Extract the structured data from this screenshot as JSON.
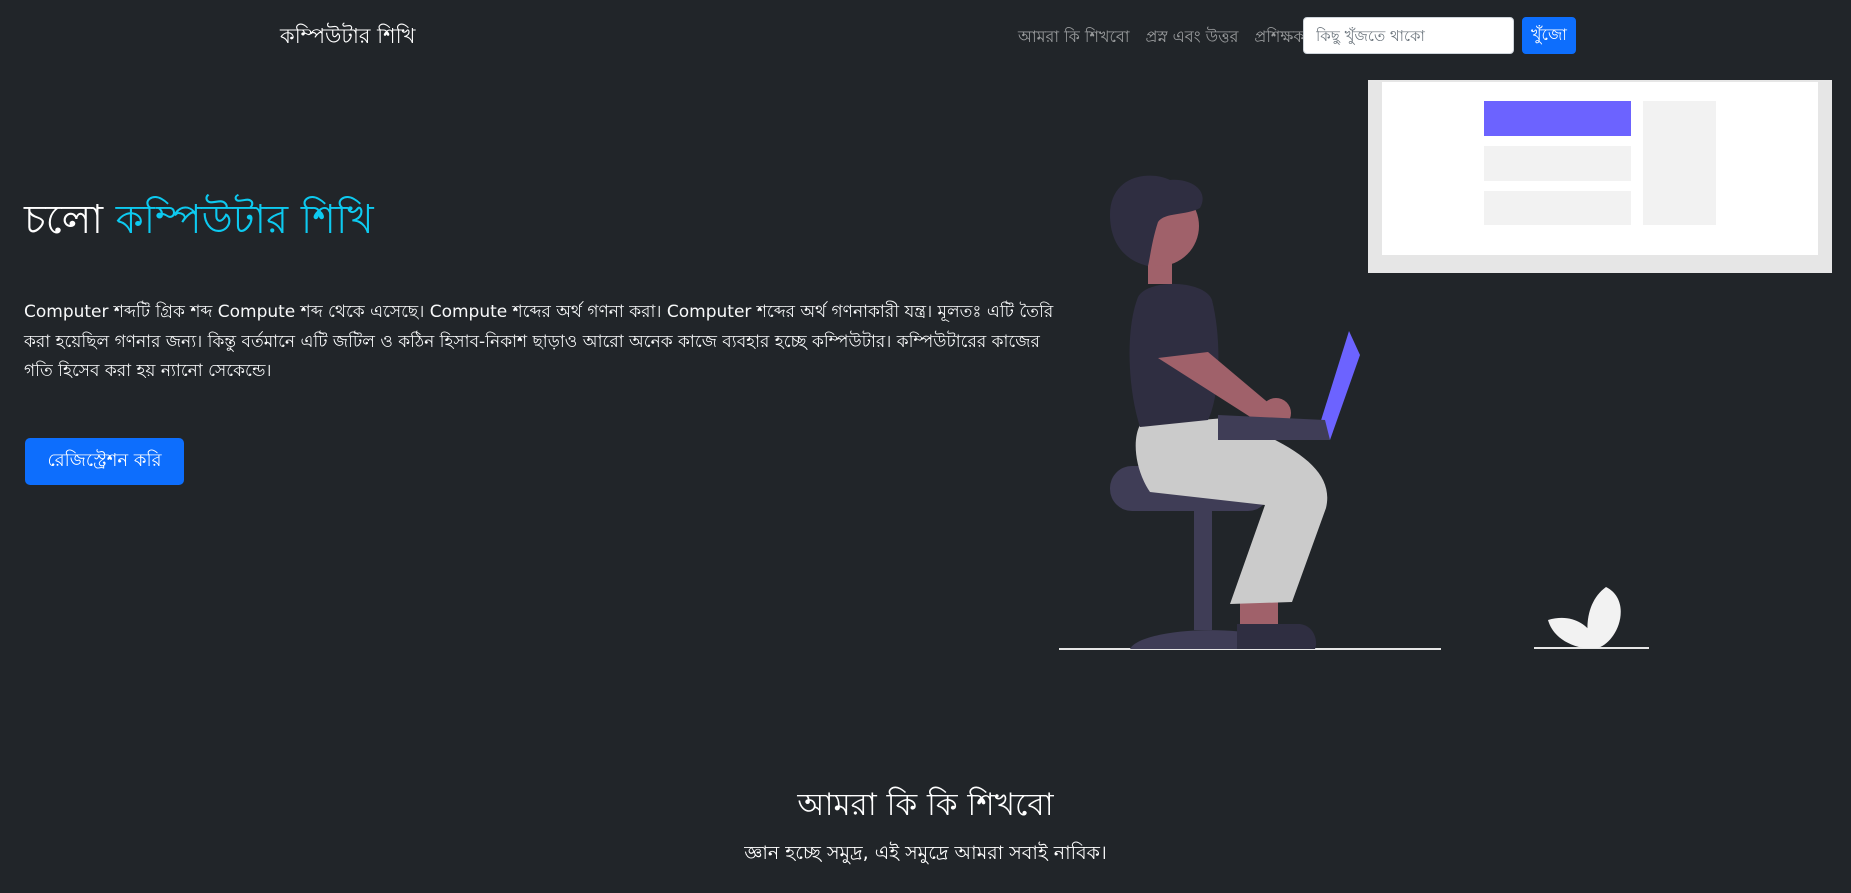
{
  "navbar": {
    "brand": "কম্পিউটার শিখি",
    "links": [
      {
        "label": "আমরা কি শিখবো"
      },
      {
        "label": "প্রস্ন এবং উত্তর"
      },
      {
        "label": "প্রশিক্ষক"
      }
    ],
    "search": {
      "placeholder": "কিছু খুঁজতে থাকো",
      "value": "",
      "button_label": "খুঁজো"
    }
  },
  "hero": {
    "title_prefix": "চলো",
    "title_accent": "কম্পিউটার শিখি",
    "description": "Computer শব্দটি গ্রিক শব্দ Compute শব্দ থেকে এসেছে। Compute শব্দের অর্থ গণনা করা। Computer শব্দের অর্থ গণনাকারী যন্ত্র। মূলতঃ এটি তৈরি করা হয়েছিল গণনার জন্য। কিন্তু বর্তমানে এটি জটিল ও কঠিন হিসাব-নিকাশ ছাড়াও আরো অনেক কাজে ব্যবহার হচ্ছে কম্পিউটার। কম্পিউটারের কাজের গতি হিসেব করা হয় ন্যানো সেকেন্ডে।",
    "button_label": "রেজিস্ট্রেশন করি"
  },
  "section": {
    "title": "আমরা কি কি শিখবো",
    "subtitle": "জ্ঞান হচ্ছে সমুদ্র, এই সমুদ্রে আমরা সবাই নাবিক।"
  },
  "colors": {
    "background": "#212529",
    "accent": "#0dcaf0",
    "primary": "#0d6efd",
    "illustration_purple": "#6c63ff"
  }
}
